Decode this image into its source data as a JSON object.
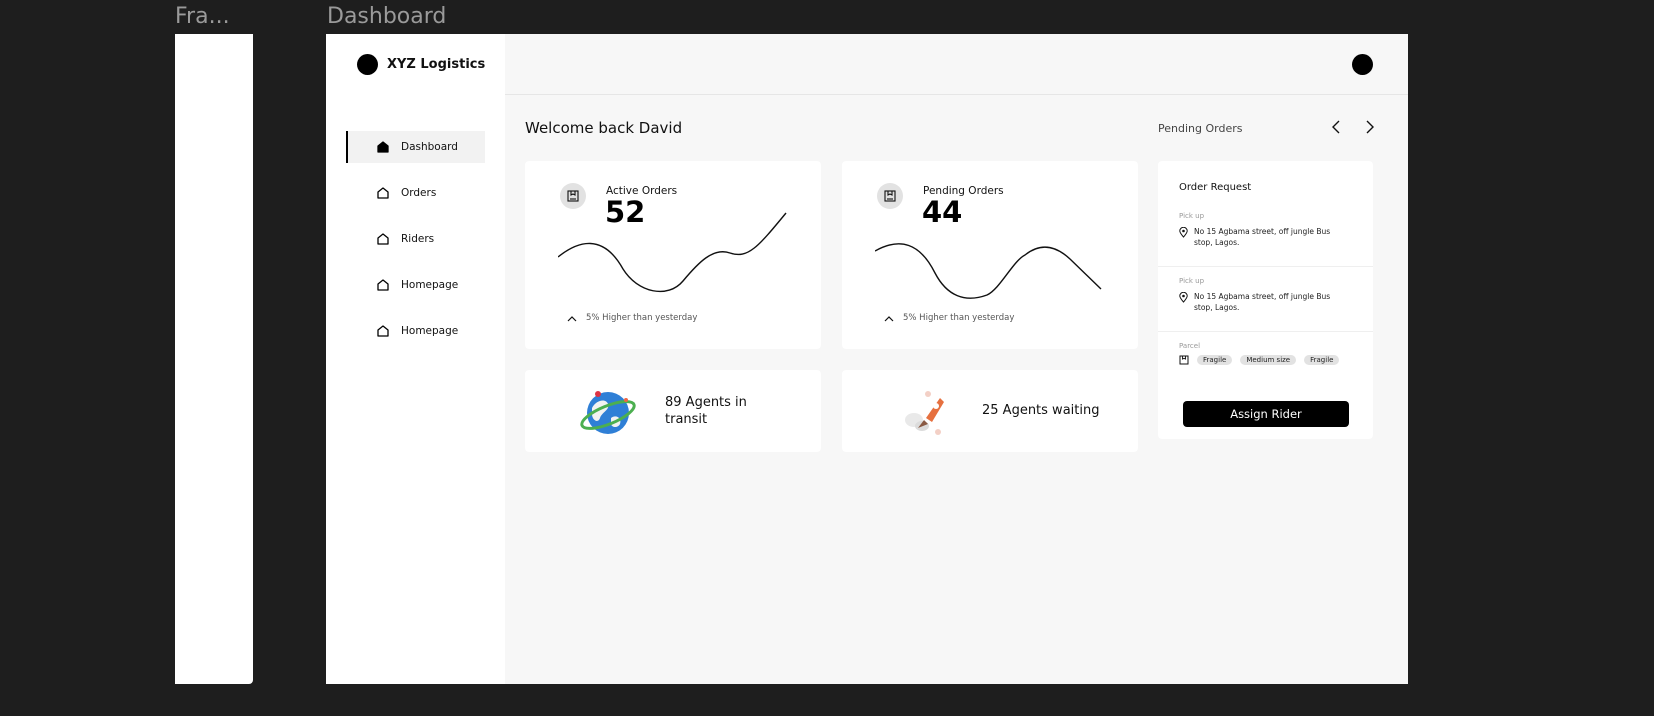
{
  "canvas": {
    "frame_label": "Fra...",
    "dashboard_label": "Dashboard"
  },
  "brand": {
    "name": "XYZ Logistics"
  },
  "sidebar": {
    "items": [
      {
        "label": "Dashboard",
        "icon": "home-icon",
        "active": true
      },
      {
        "label": "Orders",
        "icon": "home-icon",
        "active": false
      },
      {
        "label": "Riders",
        "icon": "home-icon",
        "active": false
      },
      {
        "label": "Homepage",
        "icon": "home-icon",
        "active": false
      },
      {
        "label": "Homepage",
        "icon": "home-icon",
        "active": false
      }
    ]
  },
  "header": {
    "welcome": "Welcome back David"
  },
  "stats": [
    {
      "label": "Active Orders",
      "value": "52",
      "trend": "5% Higher than yesterday",
      "icon": "package-icon"
    },
    {
      "label": "Pending Orders",
      "value": "44",
      "trend": "5% Higher than yesterday",
      "icon": "package-icon"
    }
  ],
  "agents": [
    {
      "text": "89 Agents in transit",
      "icon": "globe-illustration"
    },
    {
      "text": "25 Agents waiting",
      "icon": "rocket-illustration"
    }
  ],
  "pending": {
    "title": "Pending Orders",
    "prev_icon": "chevron-left-icon",
    "next_icon": "chevron-right-icon",
    "card": {
      "title": "Order Request",
      "sections": [
        {
          "label": "Pick up",
          "address": "No 15 Agbama street, off jungle Bus stop, Lagos."
        },
        {
          "label": "Pick up",
          "address": "No 15 Agbama street, off jungle Bus stop, Lagos."
        }
      ],
      "parcel_label": "Parcel",
      "tags": [
        "Fragile",
        "Medium size",
        "Fragile"
      ],
      "button": "Assign Rider"
    }
  },
  "colors": {
    "background": "#1e1e1e",
    "accent": "#000000",
    "panel": "#f7f7f7",
    "card": "#ffffff"
  }
}
